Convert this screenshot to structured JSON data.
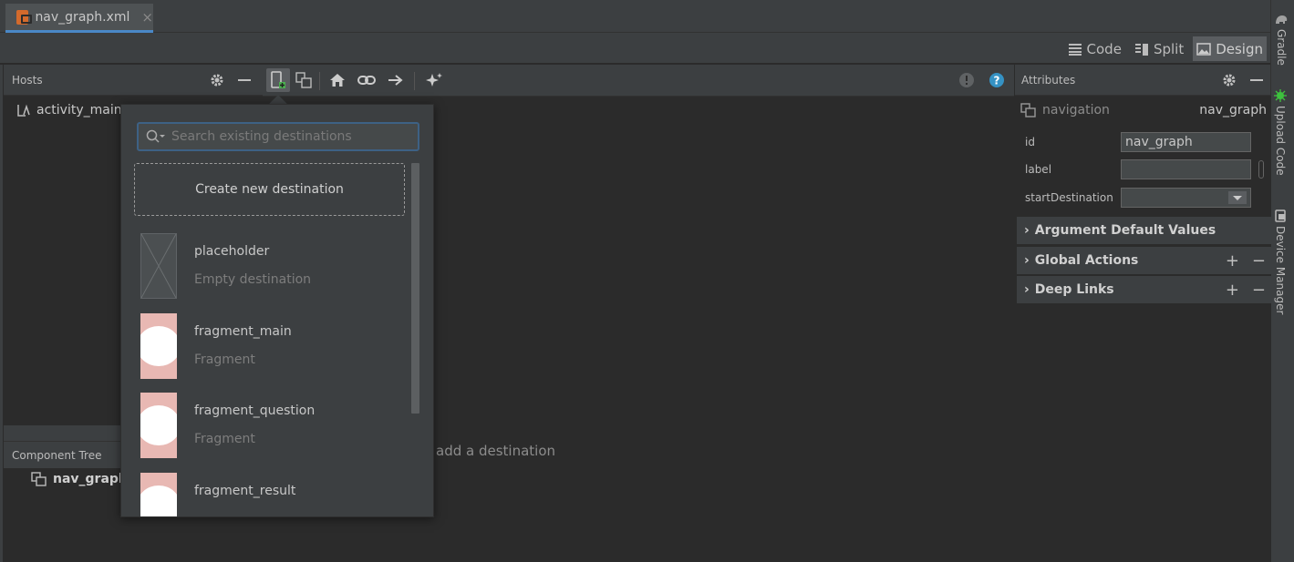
{
  "tab": {
    "label": "nav_graph.xml",
    "close": "×"
  },
  "modes": [
    {
      "label": "Code",
      "icon": "lines-icon"
    },
    {
      "label": "Split",
      "icon": "split-icon"
    },
    {
      "label": "Design",
      "icon": "image-icon"
    }
  ],
  "gutter": {
    "gradle": "Gradle",
    "upload": "Upload Code",
    "device": "Device Manager"
  },
  "hosts": {
    "title": "Hosts",
    "item": "activity_main"
  },
  "component_tree": {
    "title": "Component Tree",
    "item": "nav_graph"
  },
  "editor": {
    "hint": "add a destination"
  },
  "popup": {
    "search_placeholder": "Search existing destinations",
    "create_label": "Create new destination",
    "destinations": [
      {
        "name": "placeholder",
        "type": "Empty destination"
      },
      {
        "name": "fragment_main",
        "type": "Fragment"
      },
      {
        "name": "fragment_question",
        "type": "Fragment"
      },
      {
        "name": "fragment_result",
        "type": ""
      }
    ]
  },
  "attributes": {
    "title": "Attributes",
    "nav_type": "navigation",
    "nav_value": "nav_graph",
    "fields": {
      "id_label": "id",
      "id_value": "nav_graph",
      "label_label": "label",
      "label_value": "",
      "start_label": "startDestination",
      "start_value": ""
    },
    "sections": {
      "args": "Argument Default Values",
      "global": "Global Actions",
      "deeplinks": "Deep Links"
    }
  }
}
